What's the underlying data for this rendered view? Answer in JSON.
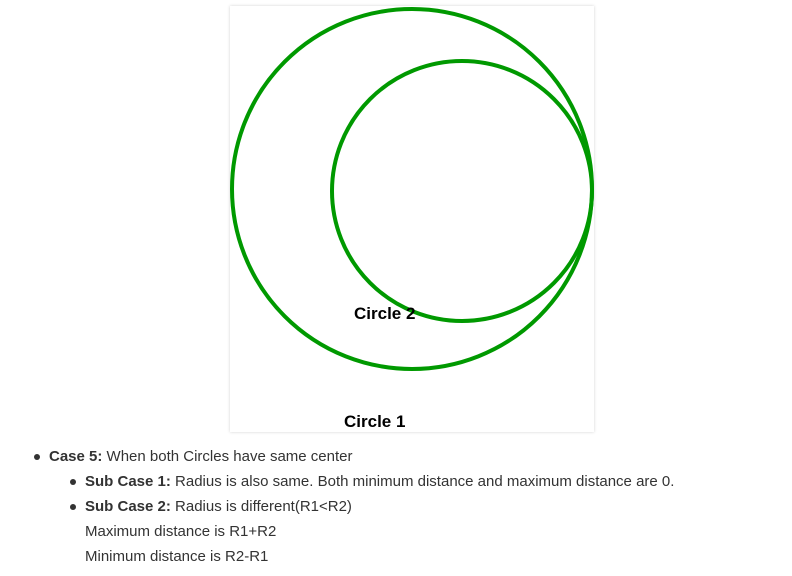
{
  "diagram": {
    "stroke_color": "#009900",
    "circle_2_label": "Circle 2",
    "circle_1_label": "Circle 1"
  },
  "notes": {
    "case5_title": "Case 5:",
    "case5_text": " When both Circles have same center",
    "sub1_title": "Sub Case 1:",
    "sub1_text": " Radius is also same. Both minimum distance and maximum distance are 0.",
    "sub2_title": "Sub Case 2:",
    "sub2_text": " Radius is different(R1<R2)",
    "max_line": "Maximum distance is R1+R2",
    "min_line": "Minimum distance is R2-R1"
  }
}
